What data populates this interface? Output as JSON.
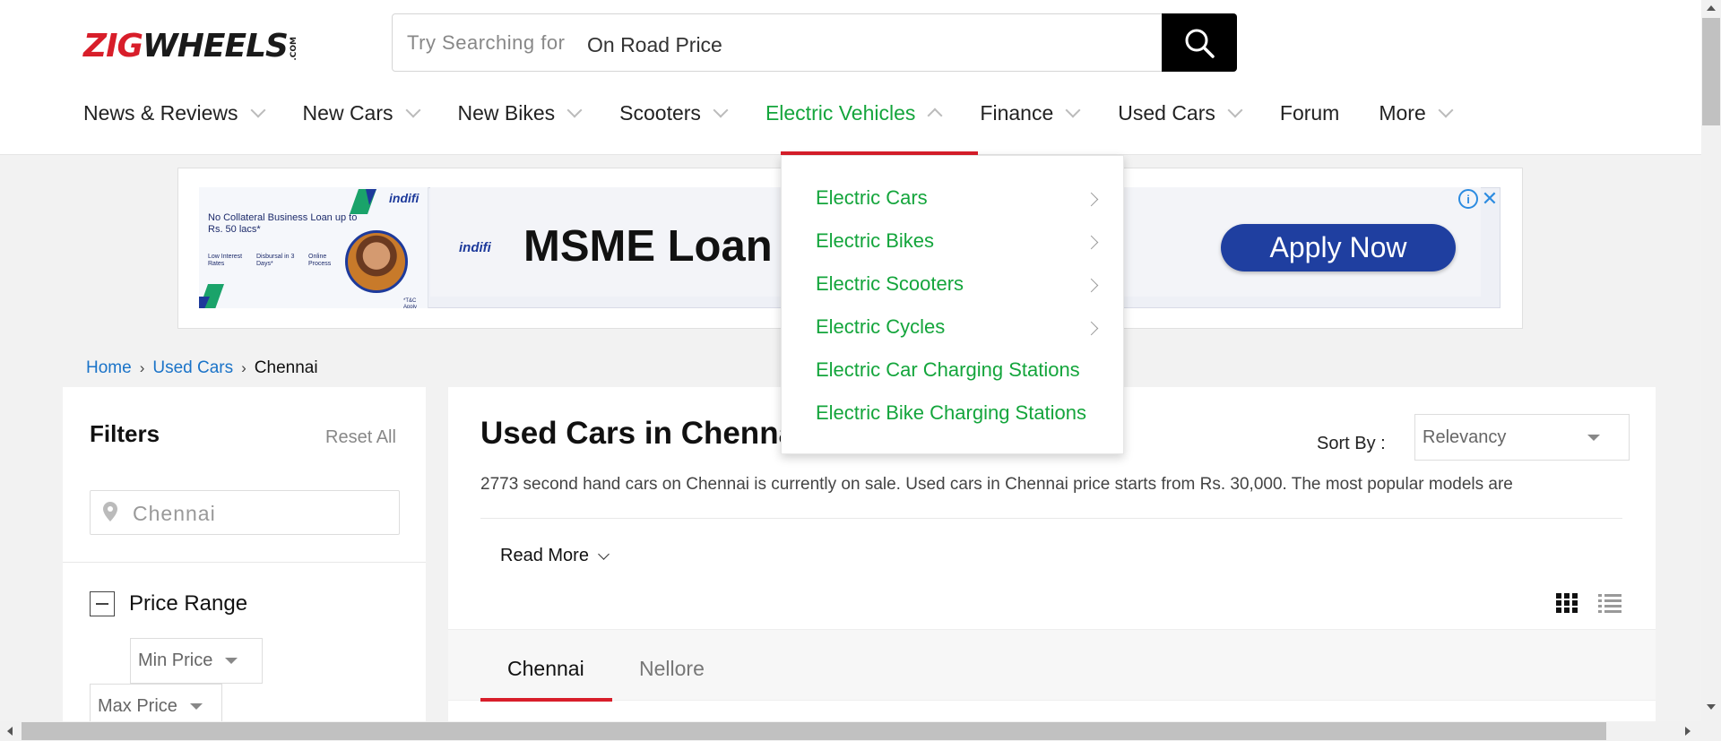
{
  "header": {
    "logo_zig": "ZIG",
    "logo_wheels": "WHEELS",
    "logo_com": ".COM",
    "search_placeholder": "Try Searching for",
    "search_value": "On Road Price",
    "search_icon": "search-icon"
  },
  "nav": {
    "items": [
      {
        "label": "News & Reviews",
        "has_chevron": true
      },
      {
        "label": "New Cars",
        "has_chevron": true
      },
      {
        "label": "New Bikes",
        "has_chevron": true
      },
      {
        "label": "Scooters",
        "has_chevron": true
      },
      {
        "label": "Electric Vehicles",
        "has_chevron": true,
        "active": true
      },
      {
        "label": "Finance",
        "has_chevron": true
      },
      {
        "label": "Used Cars",
        "has_chevron": true
      },
      {
        "label": "Forum",
        "has_chevron": false
      },
      {
        "label": "More",
        "has_chevron": true
      }
    ],
    "active_color": "#14a53c",
    "accent_color": "#d81e2a"
  },
  "dropdown": {
    "items": [
      {
        "label": "Electric Cars",
        "has_arrow": true
      },
      {
        "label": "Electric Bikes",
        "has_arrow": true
      },
      {
        "label": "Electric Scooters",
        "has_arrow": true
      },
      {
        "label": "Electric Cycles",
        "has_arrow": true
      },
      {
        "label": "Electric Car Charging Stations",
        "has_arrow": false
      },
      {
        "label": "Electric Bike Charging Stations",
        "has_arrow": false
      }
    ]
  },
  "ad": {
    "left_brand": "indifi",
    "left_headline": "No Collateral Business Loan up to Rs. 50 lacs*",
    "left_features": [
      "Low Interest Rates",
      "Disbursal in 3 Days*",
      "Online Process"
    ],
    "left_tc": "*T&C Apply",
    "brand": "indifi",
    "headline": "MSME Loan o",
    "cta": "Apply Now",
    "info_icon": "info-icon",
    "close_icon": "close-icon"
  },
  "breadcrumb": {
    "items": [
      "Home",
      "Used Cars"
    ],
    "current": "Chennai"
  },
  "filters": {
    "title": "Filters",
    "reset": "Reset All",
    "location_value": "Chennai",
    "price_range_title": "Price Range",
    "min_price": "Min Price",
    "max_price": "Max Price"
  },
  "main": {
    "title": "Used Cars in Chennai",
    "sort_label": "Sort By :",
    "sort_value": "Relevancy",
    "description": "2773 second hand cars on Chennai is currently on sale. Used cars in Chennai price starts from Rs. 30,000. The most popular models are",
    "read_more": "Read More",
    "tabs": [
      {
        "label": "Chennai",
        "active": true
      },
      {
        "label": "Nellore",
        "active": false
      }
    ]
  }
}
